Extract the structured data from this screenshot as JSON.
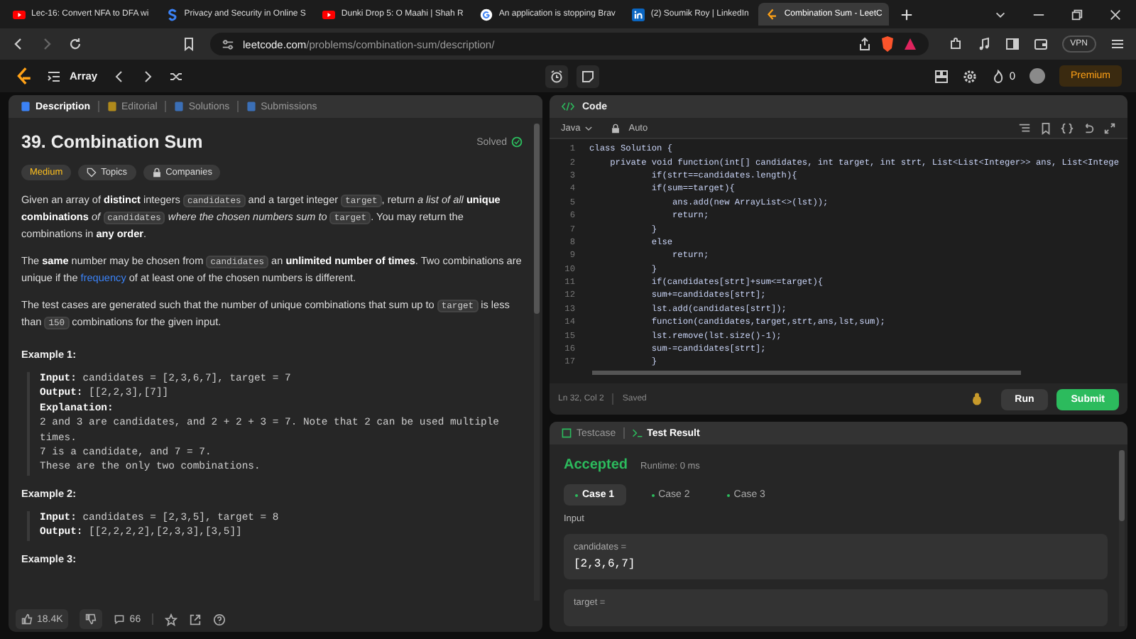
{
  "browser": {
    "tabs": [
      {
        "kind": "youtube",
        "title": "Lec-16: Convert NFA to DFA wi",
        "selected": false
      },
      {
        "kind": "letter-s",
        "title": "Privacy and Security in Online S",
        "selected": false
      },
      {
        "kind": "youtube",
        "title": "Dunki Drop 5: O Maahi | Shah R",
        "selected": false
      },
      {
        "kind": "google",
        "title": "An application is stopping Brav",
        "selected": false
      },
      {
        "kind": "linkedin",
        "title": "(2) Soumik Roy | LinkedIn",
        "selected": false
      },
      {
        "kind": "leetcode",
        "title": "Combination Sum - LeetC",
        "selected": true
      }
    ],
    "address": {
      "domain": "leetcode.com",
      "path": "/problems/combination-sum/description/"
    },
    "vpn_label": "VPN"
  },
  "nav": {
    "list_label": "Array",
    "streak": "0",
    "premium": "Premium"
  },
  "problem": {
    "tabs": [
      {
        "label": "Description",
        "selected": true
      },
      {
        "label": "Editorial",
        "selected": false
      },
      {
        "label": "Solutions",
        "selected": false
      },
      {
        "label": "Submissions",
        "selected": false
      }
    ],
    "title": "39. Combination Sum",
    "status": "Solved",
    "difficulty": "Medium",
    "tags": [
      "Topics",
      "Companies"
    ],
    "paragraphs": [
      [
        {
          "kind": "text",
          "text": "Given an array of **distinct** integers "
        },
        {
          "kind": "code",
          "text": "candidates"
        },
        {
          "kind": "text",
          "text": " and a target integer "
        },
        {
          "kind": "code",
          "text": "target"
        },
        {
          "kind": "text",
          "text": ", return *a list of all* **unique combinations** *of* "
        },
        {
          "kind": "code",
          "text": "candidates"
        },
        {
          "kind": "text",
          "text": " *where the chosen numbers sum to* "
        },
        {
          "kind": "code",
          "text": "target"
        },
        {
          "kind": "text",
          "text": ". You may return the combinations in **any order**."
        }
      ],
      [
        {
          "kind": "text",
          "text": "The **same** number may be chosen from "
        },
        {
          "kind": "code",
          "text": "candidates"
        },
        {
          "kind": "text",
          "text": " an **unlimited number of times**. Two combinations are unique if the "
        },
        {
          "kind": "link",
          "text": "frequency"
        },
        {
          "kind": "text",
          "text": " of at least one of the chosen numbers is different."
        }
      ],
      [
        {
          "kind": "text",
          "text": "The test cases are generated such that the number of unique combinations that sum up to "
        },
        {
          "kind": "code",
          "text": "target"
        },
        {
          "kind": "text",
          "text": " is less than "
        },
        {
          "kind": "code",
          "text": "150"
        },
        {
          "kind": "text",
          "text": " combinations for the given input."
        }
      ]
    ],
    "examples": [
      {
        "title": "Example 1:",
        "lines": [
          {
            "label": "Input:",
            "text": " candidates = [2,3,6,7], target = 7"
          },
          {
            "label": "Output:",
            "text": " [[2,2,3],[7]]"
          },
          {
            "label": "Explanation:"
          },
          {
            "text": "2 and 3 are candidates, and 2 + 2 + 3 = 7. Note that 2 can be used multiple times."
          },
          {
            "text": "7 is a candidate, and 7 = 7."
          },
          {
            "text": "These are the only two combinations."
          }
        ]
      },
      {
        "title": "Example 2:",
        "lines": [
          {
            "label": "Input:",
            "text": " candidates = [2,3,5], target = 8"
          },
          {
            "label": "Output:",
            "text": " [[2,2,2,2],[2,3,3],[3,5]]"
          }
        ]
      },
      {
        "title": "Example 3:"
      }
    ],
    "likes": "18.4K",
    "comments": "66"
  },
  "editor": {
    "title": "Code",
    "language": "Java",
    "mode": "Auto",
    "lines": [
      {
        "num": "1",
        "code": "class Solution {"
      },
      {
        "num": "2",
        "code": "    private void function(int[] candidates, int target, int strt, List<List<Integer>> ans, List<Intege"
      },
      {
        "num": "3",
        "code": "            if(strt==candidates.length){"
      },
      {
        "num": "4",
        "code": "            if(sum==target){"
      },
      {
        "num": "5",
        "code": "                ans.add(new ArrayList<>(lst));"
      },
      {
        "num": "6",
        "code": "                return;"
      },
      {
        "num": "7",
        "code": "            }"
      },
      {
        "num": "8",
        "code": "            else"
      },
      {
        "num": "9",
        "code": "                return;"
      },
      {
        "num": "10",
        "code": "            }"
      },
      {
        "num": "11",
        "code": "            if(candidates[strt]+sum<=target){"
      },
      {
        "num": "12",
        "code": "            sum+=candidates[strt];"
      },
      {
        "num": "13",
        "code": "            lst.add(candidates[strt]);"
      },
      {
        "num": "14",
        "code": "            function(candidates,target,strt,ans,lst,sum);"
      },
      {
        "num": "15",
        "code": "            lst.remove(lst.size()-1);"
      },
      {
        "num": "16",
        "code": "            sum-=candidates[strt];"
      },
      {
        "num": "17",
        "code": "            }"
      }
    ],
    "position": "Ln 32, Col 2",
    "save_state": "Saved",
    "run": "Run",
    "submit": "Submit"
  },
  "results": {
    "tabs": [
      {
        "label": "Testcase",
        "selected": false
      },
      {
        "label": "Test Result",
        "selected": true
      }
    ],
    "verdict": "Accepted",
    "runtime": "Runtime: 0 ms",
    "cases": [
      {
        "label": "Case 1",
        "selected": true
      },
      {
        "label": "Case 2",
        "selected": false
      },
      {
        "label": "Case 3",
        "selected": false
      }
    ],
    "input_label": "Input",
    "inputs": [
      {
        "name": "candidates =",
        "value": "[2,3,6,7]"
      },
      {
        "name": "target ="
      }
    ]
  }
}
